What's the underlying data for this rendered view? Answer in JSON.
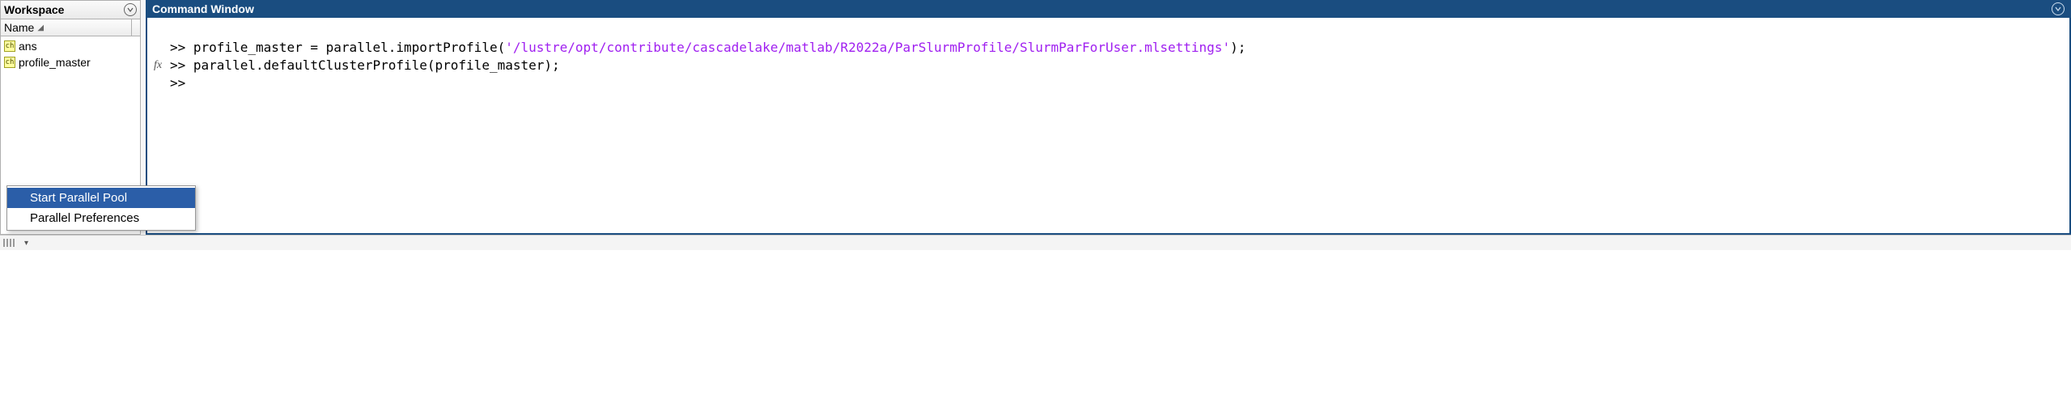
{
  "workspace": {
    "title": "Workspace",
    "column_header": "Name",
    "variables": [
      {
        "name": "ans"
      },
      {
        "name": "profile_master"
      }
    ]
  },
  "command_window": {
    "title": "Command Window",
    "fx_indicator": "fx",
    "prompt": ">>",
    "lines": [
      {
        "prefix": ">> profile_master = parallel.importProfile(",
        "string": "'/lustre/opt/contribute/cascadelake/matlab/R2022a/ParSlurmProfile/SlurmParForUser.mlsettings'",
        "suffix": ");"
      },
      {
        "prefix": ">> parallel.defaultClusterProfile(profile_master);",
        "string": "",
        "suffix": ""
      },
      {
        "prefix": ">> ",
        "string": "",
        "suffix": ""
      }
    ]
  },
  "context_menu": {
    "items": [
      {
        "label": "Start Parallel Pool",
        "selected": true
      },
      {
        "label": "Parallel Preferences",
        "selected": false
      }
    ]
  }
}
